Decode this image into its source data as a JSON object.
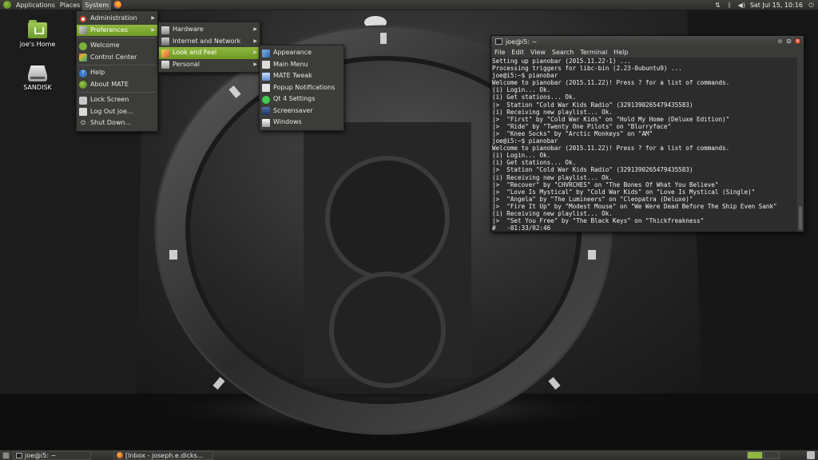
{
  "top_panel": {
    "menus": [
      "Applications",
      "Places",
      "System"
    ],
    "clock": "Sat Jul 15, 10:16"
  },
  "desktop": {
    "icons": [
      {
        "label": "joe's Home",
        "icon": "home-folder-icon"
      },
      {
        "label": "SANDISK",
        "icon": "drive-icon"
      }
    ]
  },
  "system_menu": {
    "items": [
      {
        "label": "Administration",
        "submenu": true
      },
      {
        "label": "Preferences",
        "submenu": true
      },
      {
        "label": "Welcome"
      },
      {
        "label": "Control Center"
      },
      {
        "label": "Help"
      },
      {
        "label": "About MATE"
      },
      {
        "label": "Lock Screen"
      },
      {
        "label": "Log Out joe..."
      },
      {
        "label": "Shut Down..."
      }
    ]
  },
  "preferences_menu": {
    "items": [
      {
        "label": "Hardware",
        "submenu": true
      },
      {
        "label": "Internet and Network",
        "submenu": true
      },
      {
        "label": "Look and Feel",
        "submenu": true
      },
      {
        "label": "Personal",
        "submenu": true
      }
    ]
  },
  "look_menu": {
    "items": [
      {
        "label": "Appearance"
      },
      {
        "label": "Main Menu"
      },
      {
        "label": "MATE Tweak"
      },
      {
        "label": "Popup Notifications"
      },
      {
        "label": "Qt 4 Settings"
      },
      {
        "label": "Screensaver"
      },
      {
        "label": "Windows"
      }
    ]
  },
  "terminal": {
    "title": "joe@i5: ~",
    "menus": [
      "File",
      "Edit",
      "View",
      "Search",
      "Terminal",
      "Help"
    ],
    "lines": [
      "Setting up pianobar (2015.11.22-1) ...",
      "Processing triggers for libc-bin (2.23-0ubuntu9) ...",
      "joe@i5:~$ pianobar",
      "Welcome to pianobar (2015.11.22)! Press ? for a list of commands.",
      "(i) Login... Ok.",
      "(i) Get stations... Ok.",
      "|>  Station \"Cold War Kids Radio\" (3291390265479435583)",
      "(i) Receiving new playlist... Ok.",
      "|>  \"First\" by \"Cold War Kids\" on \"Hold My Home (Deluxe Edition)\"",
      "|>  \"Ride\" by \"Twenty One Pilots\" on \"Blurryface\"",
      "|>  \"Knee Socks\" by \"Arctic Monkeys\" on \"AM\"",
      "joe@i5:~$ pianobar",
      "Welcome to pianobar (2015.11.22)! Press ? for a list of commands.",
      "(i) Login... Ok.",
      "(i) Get stations... Ok.",
      "|>  Station \"Cold War Kids Radio\" (3291390265479435583)",
      "(i) Receiving new playlist... Ok.",
      "|>  \"Recover\" by \"CHVRCHES\" on \"The Bones Of What You Believe\"",
      "|>  \"Love Is Mystical\" by \"Cold War Kids\" on \"Love Is Mystical (Single)\"",
      "|>  \"Angela\" by \"The Lumineers\" on \"Cleopatra (Deluxe)\"",
      "|>  \"Fire It Up\" by \"Modest Mouse\" on \"We Were Dead Before The Ship Even Sank\"",
      "(i) Receiving new playlist... Ok.",
      "|>  \"Set You Free\" by \"The Black Keys\" on \"Thickfreakness\"",
      "#   -01:33/02:46"
    ]
  },
  "bottom_panel": {
    "tasks": [
      {
        "label": "joe@i5: ~"
      },
      {
        "label": "[Inbox - joseph.e.dicks..."
      }
    ]
  },
  "colors": {
    "accent": "#7fa832",
    "panel": "#353533",
    "menu_bg": "#3c3c39"
  }
}
